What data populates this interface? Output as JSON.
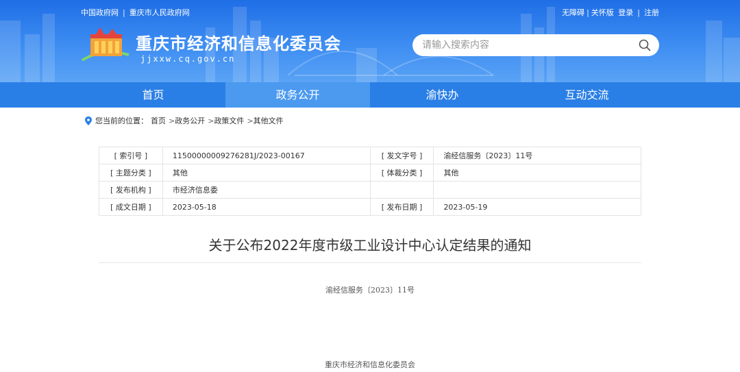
{
  "top_links": {
    "left": [
      "中国政府网",
      "重庆市人民政府网"
    ],
    "right": [
      "无障碍",
      "关怀版",
      "登录",
      "注册"
    ]
  },
  "site": {
    "title": "重庆市经济和信息化委员会",
    "domain": "jjxxw.cq.gov.cn"
  },
  "search": {
    "placeholder": "请输入搜索内容",
    "icon": "search-icon"
  },
  "nav": {
    "items": [
      "首页",
      "政务公开",
      "渝快办",
      "互动交流"
    ],
    "active": "政务公开"
  },
  "breadcrumb": {
    "prefix": "您当前的位置：",
    "items": [
      "首页",
      "政务公开",
      "政策文件",
      "其他文件"
    ],
    "separator": ">"
  },
  "meta": {
    "rows": [
      [
        {
          "label": "[ 索引号 ]",
          "value": "11500000009276281J/2023-00167"
        },
        {
          "label": "[ 发文字号 ]",
          "value": "渝经信服务〔2023〕11号"
        }
      ],
      [
        {
          "label": "[ 主题分类 ]",
          "value": "其他"
        },
        {
          "label": "[ 体裁分类 ]",
          "value": "其他"
        }
      ],
      [
        {
          "label": "[ 发布机构 ]",
          "value": "市经济信息委"
        },
        {
          "label": "",
          "value": ""
        }
      ],
      [
        {
          "label": "[ 成文日期 ]",
          "value": "2023-05-18"
        },
        {
          "label": "[ 发布日期 ]",
          "value": "2023-05-19"
        }
      ]
    ]
  },
  "article": {
    "title": "关于公布2022年度市级工业设计中心认定结果的通知",
    "doc_number": "渝经信服务〔2023〕11号",
    "sender": "重庆市经济和信息化委员会"
  },
  "colors": {
    "brand_blue": "#2a7fe6",
    "nav_active": "#4b9af0",
    "header_top": "#1f6ee6"
  }
}
